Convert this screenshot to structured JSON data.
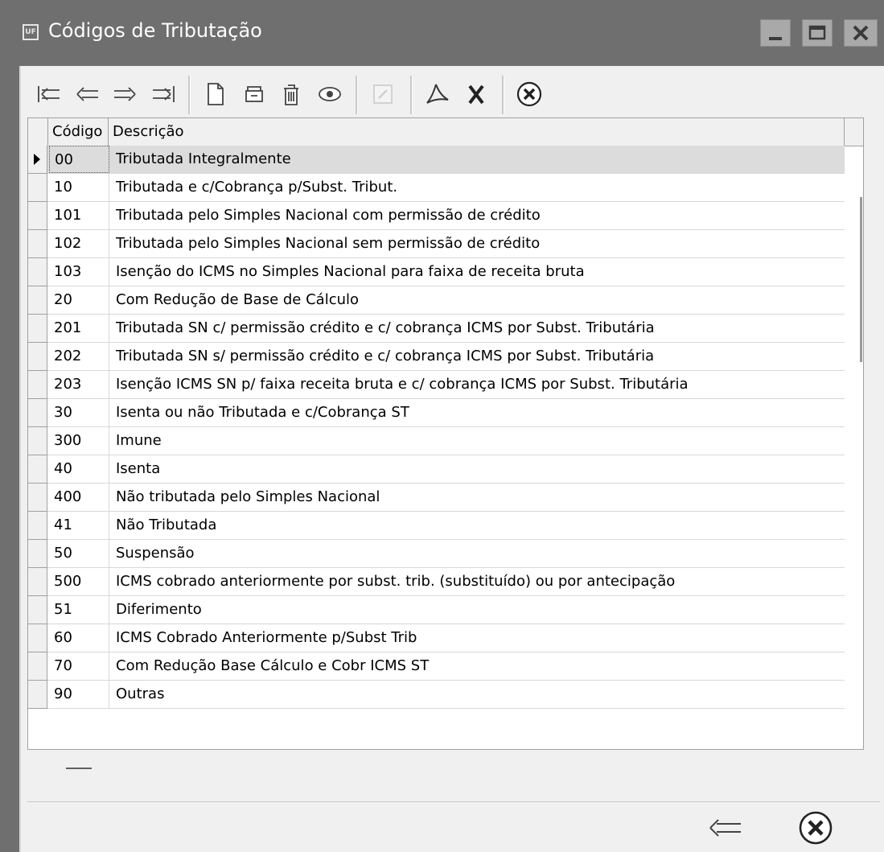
{
  "window": {
    "app_icon": "UF",
    "title": "Códigos de Tributação"
  },
  "toolbar": {
    "icons": [
      "first-record-icon",
      "prior-record-icon",
      "next-record-icon",
      "last-record-icon",
      "new-document-icon",
      "cabinet-icon",
      "trash-icon",
      "eye-icon",
      "edit-disabled-icon",
      "pdf-icon",
      "export-x-icon",
      "close-circle-icon"
    ]
  },
  "table": {
    "columns": [
      "Código",
      "Descrição"
    ],
    "rows": [
      {
        "code": "00",
        "desc": "Tributada Integralmente"
      },
      {
        "code": "10",
        "desc": "Tributada e c/Cobrança p/Subst. Tribut."
      },
      {
        "code": "101",
        "desc": "Tributada pelo Simples Nacional com permissão de crédito"
      },
      {
        "code": "102",
        "desc": "Tributada pelo Simples Nacional sem permissão de crédito"
      },
      {
        "code": "103",
        "desc": "Isenção do ICMS no Simples Nacional para faixa de receita bruta"
      },
      {
        "code": "20",
        "desc": "Com Redução de Base de Cálculo"
      },
      {
        "code": "201",
        "desc": "Tributada SN c/ permissão crédito e c/ cobrança ICMS por Subst. Tributária"
      },
      {
        "code": "202",
        "desc": "Tributada SN s/ permissão crédito e c/ cobrança ICMS por Subst. Tributária"
      },
      {
        "code": "203",
        "desc": "Isenção ICMS SN p/ faixa receita bruta e c/ cobrança ICMS por Subst. Tributária"
      },
      {
        "code": "30",
        "desc": "Isenta ou não Tributada e c/Cobrança ST"
      },
      {
        "code": "300",
        "desc": "Imune"
      },
      {
        "code": "40",
        "desc": "Isenta"
      },
      {
        "code": "400",
        "desc": "Não tributada pelo Simples Nacional"
      },
      {
        "code": "41",
        "desc": "Não Tributada"
      },
      {
        "code": "50",
        "desc": "Suspensão"
      },
      {
        "code": "500",
        "desc": "ICMS cobrado anteriormente por subst. trib. (substituído) ou por antecipação"
      },
      {
        "code": "51",
        "desc": "Diferimento"
      },
      {
        "code": "60",
        "desc": "ICMS Cobrado Anteriormente p/Subst Trib"
      },
      {
        "code": "70",
        "desc": "Com Redução Base Cálculo e Cobr ICMS ST"
      },
      {
        "code": "90",
        "desc": "Outras"
      }
    ],
    "selected_row": 0
  },
  "footer": {
    "buttons": [
      "back-arrow-icon",
      "close-circle-icon"
    ]
  }
}
